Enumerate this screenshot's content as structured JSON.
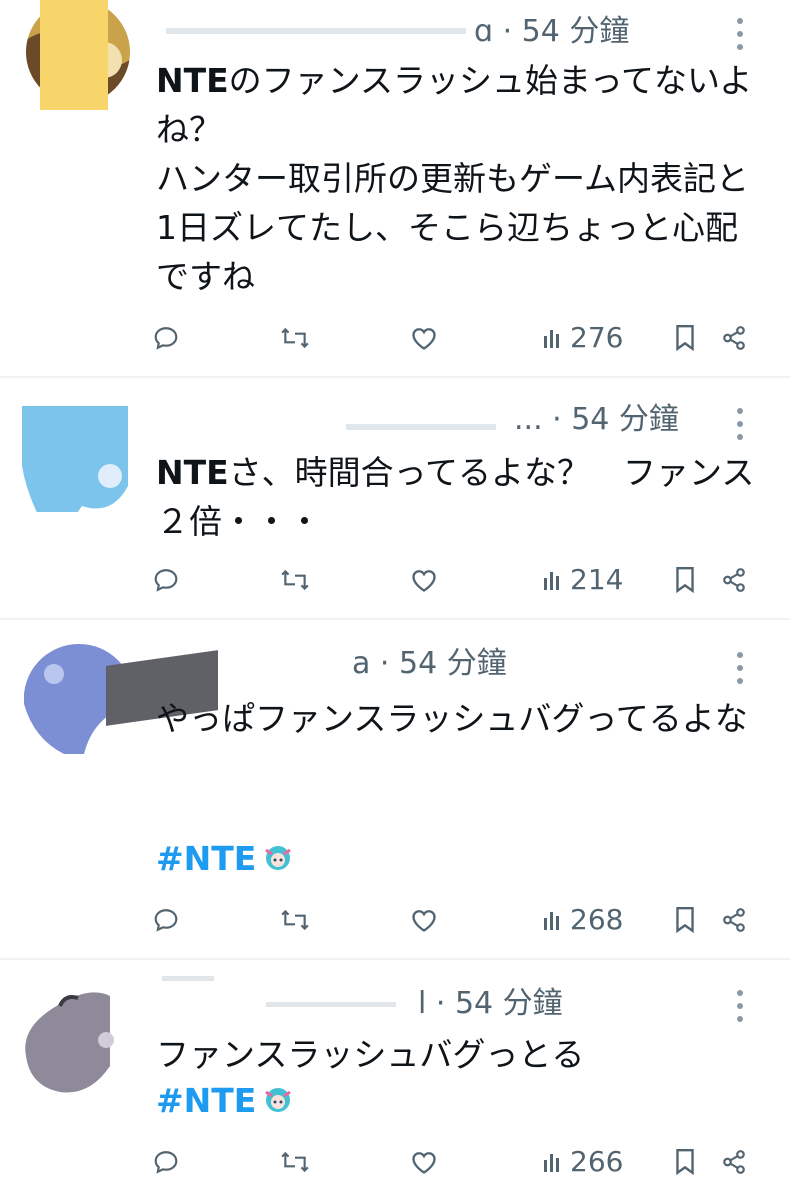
{
  "colors": {
    "accent": "#1d9bf0",
    "muted": "#536471",
    "text": "#0f1419",
    "divider": "#eff3f4"
  },
  "icons": {
    "reply": "reply-icon",
    "repost": "repost-icon",
    "like": "heart-icon",
    "views": "views-icon",
    "bookmark": "bookmark-icon",
    "share": "share-icon",
    "more": "more-dots-icon"
  },
  "posts": [
    {
      "meta": "ɑ · 54 分鐘",
      "text_bold": "NTE",
      "text": "のファンスラッシュ始まってないよね？\nハンター取引所の更新もゲーム内表記と1日ズレてたし、そこら辺ちょっと心配ですね",
      "hashtag": "",
      "views": "276"
    },
    {
      "meta": "... · 54 分鐘",
      "text_bold": "NTE",
      "text": "さ、時間合ってるよな？　ファンス２倍・・・",
      "hashtag": "",
      "views": "214"
    },
    {
      "meta": "a · 54 分鐘",
      "text_bold": "",
      "text": "やっぱファンスラッシュバグってるよな",
      "hashtag": "#NTE",
      "views": "268"
    },
    {
      "meta": "l · 54 分鐘",
      "text_bold": "",
      "text": "ファンスラッシュバグっとる",
      "hashtag": "#NTE",
      "views": "266"
    }
  ]
}
